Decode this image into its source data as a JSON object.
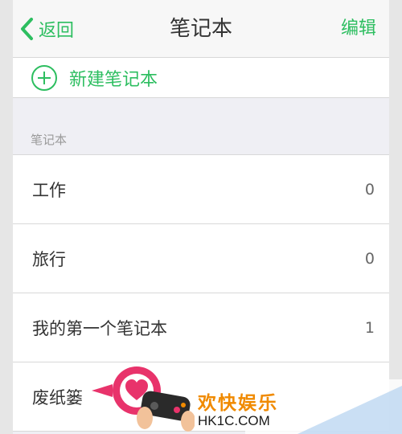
{
  "nav": {
    "back_label": "返回",
    "title": "笔记本",
    "edit_label": "编辑"
  },
  "new_notebook": {
    "label": "新建笔记本",
    "icon": "plus-circle-icon"
  },
  "section": {
    "label": "笔记本"
  },
  "notebooks": [
    {
      "name": "工作",
      "count": "0"
    },
    {
      "name": "旅行",
      "count": "0"
    },
    {
      "name": "我的第一个笔记本",
      "count": "1"
    },
    {
      "name": "废纸篓",
      "count": ""
    }
  ],
  "watermark": {
    "line1": "欢快娱乐",
    "line2": "HK1C.COM"
  },
  "colors": {
    "accent": "#2dbe60",
    "background": "#efeff4",
    "watermark_pink": "#e8336b",
    "watermark_orange": "#f08a00"
  }
}
